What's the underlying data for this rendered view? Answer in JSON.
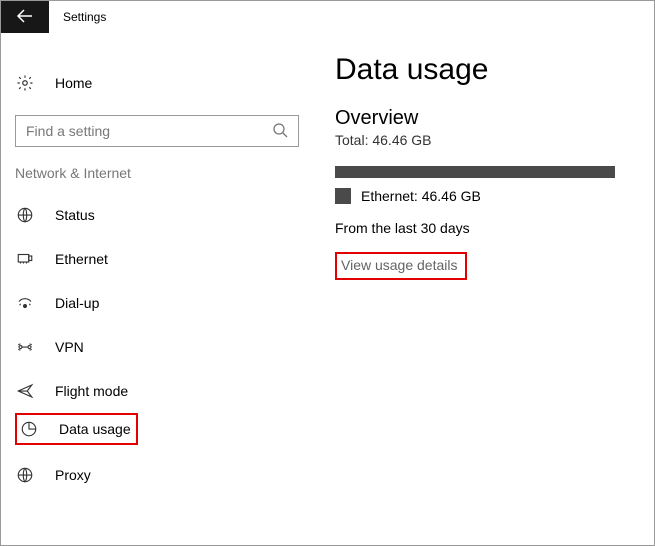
{
  "titlebar": {
    "title": "Settings"
  },
  "sidebar": {
    "home_label": "Home",
    "search_placeholder": "Find a setting",
    "category_label": "Network & Internet",
    "items": [
      {
        "label": "Status"
      },
      {
        "label": "Ethernet"
      },
      {
        "label": "Dial-up"
      },
      {
        "label": "VPN"
      },
      {
        "label": "Flight mode"
      },
      {
        "label": "Data usage"
      },
      {
        "label": "Proxy"
      }
    ]
  },
  "main": {
    "page_title": "Data usage",
    "overview_title": "Overview",
    "total_line": "Total: 46.46 GB",
    "legend": "Ethernet: 46.46 GB",
    "period": "From the last 30 days",
    "link": "View usage details"
  }
}
